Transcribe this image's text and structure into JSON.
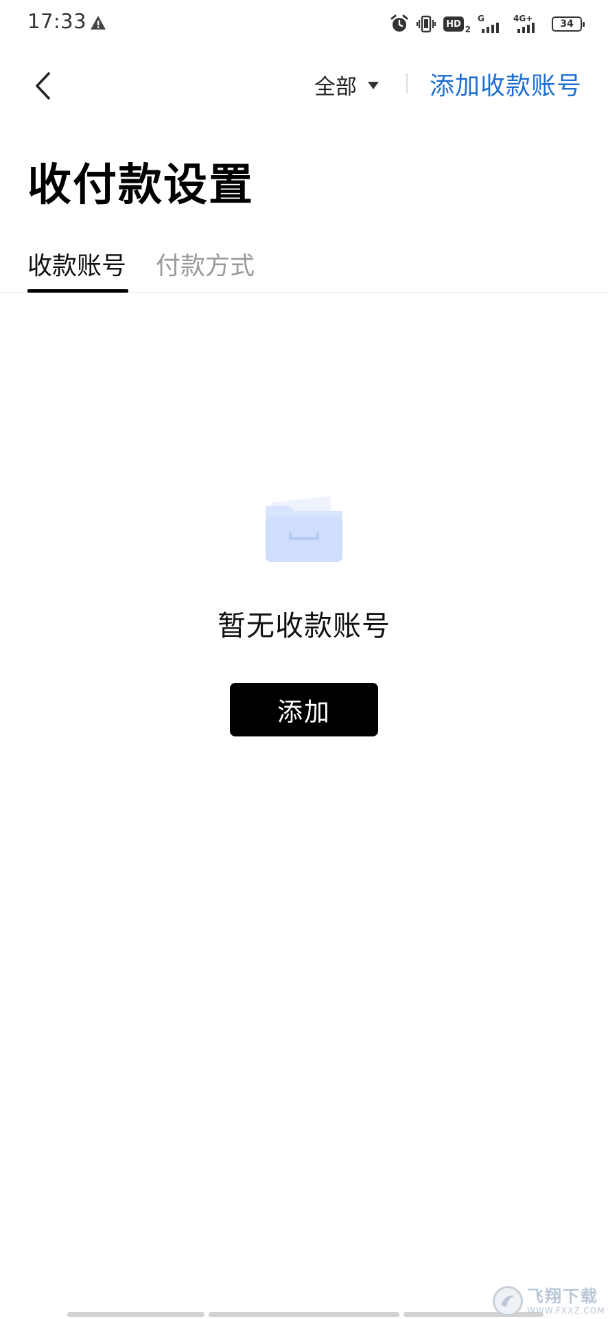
{
  "status_bar": {
    "time": "17:33",
    "hd_label": "HD",
    "hd_sub": "2",
    "signal1_label": "G",
    "signal2_label": "4G+",
    "battery": "34"
  },
  "header": {
    "filter_label": "全部",
    "add_account_link": "添加收款账号"
  },
  "page": {
    "title": "收付款设置"
  },
  "tabs": [
    {
      "label": "收款账号",
      "active": true
    },
    {
      "label": "付款方式",
      "active": false
    }
  ],
  "empty_state": {
    "text": "暂无收款账号",
    "button_label": "添加"
  },
  "watermark": {
    "cn": "飞翔下载",
    "en": "WWW.FXXZ.COM"
  },
  "colors": {
    "accent": "#1f6fd1",
    "tab_active": "#111111",
    "tab_inactive": "#9a9a9a",
    "button_bg": "#000000",
    "illustration": "#cfdefb"
  }
}
